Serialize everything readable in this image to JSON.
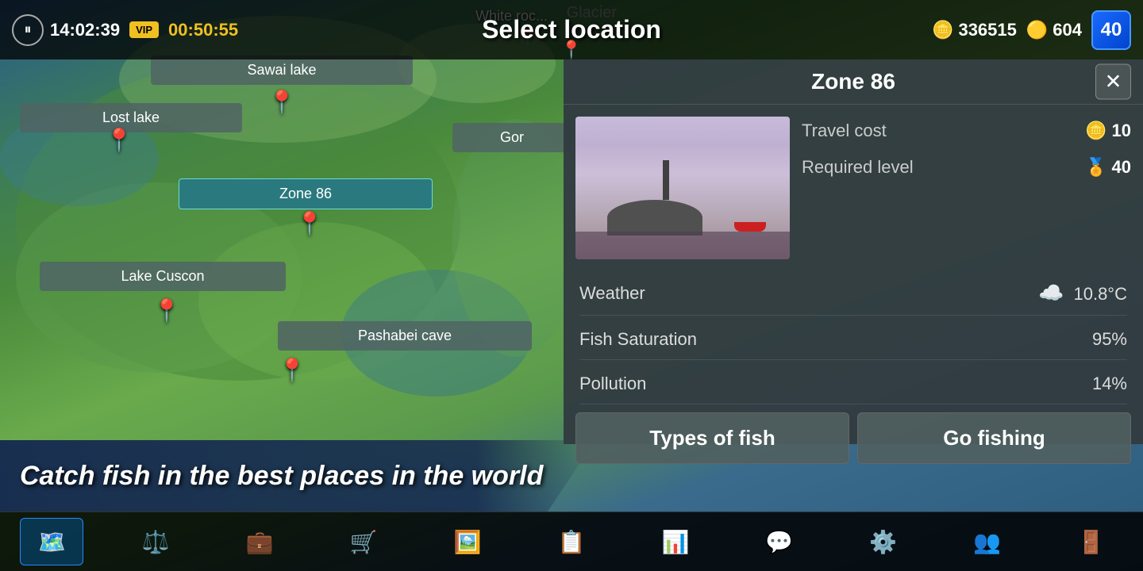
{
  "topbar": {
    "time": "14:02:39",
    "vip_label": "VIP",
    "timer": "00:50:55",
    "select_location": "Select location",
    "coins_label": "336515",
    "gold_label": "604",
    "level": "40"
  },
  "map": {
    "locations": [
      {
        "name": "Sawai lake",
        "active": false
      },
      {
        "name": "Lost lake",
        "active": false
      },
      {
        "name": "Zone 86",
        "active": true
      },
      {
        "name": "Lake Cuscon",
        "active": false
      },
      {
        "name": "Pashabei cave",
        "active": false
      },
      {
        "name": "Gor",
        "active": false
      }
    ],
    "glacier_label": "Glacier",
    "white_rocks_label": "White roc..."
  },
  "zone_panel": {
    "title": "Zone 86",
    "close_label": "✕",
    "travel_cost_label": "Travel cost",
    "travel_cost_value": "10",
    "required_level_label": "Required level",
    "required_level_value": "40",
    "weather_label": "Weather",
    "weather_value": "10.8°C",
    "fish_saturation_label": "Fish Saturation",
    "fish_saturation_value": "95%",
    "pollution_label": "Pollution",
    "pollution_value": "14%",
    "types_of_fish_btn": "Types of fish",
    "go_fishing_btn": "Go fishing"
  },
  "banner": {
    "text": "Catch fish in the best places in the world"
  },
  "navbar": {
    "items": [
      {
        "icon": "🗺️",
        "label": "map",
        "active": true
      },
      {
        "icon": "⚖️",
        "label": "balance",
        "active": false
      },
      {
        "icon": "💼",
        "label": "inventory",
        "active": false
      },
      {
        "icon": "🛒",
        "label": "shop",
        "active": false
      },
      {
        "icon": "🖼️",
        "label": "gallery",
        "active": false
      },
      {
        "icon": "📋",
        "label": "tasks",
        "active": false
      },
      {
        "icon": "📊",
        "label": "stats",
        "active": false
      },
      {
        "icon": "💬",
        "label": "chat",
        "active": false
      },
      {
        "icon": "⚙️",
        "label": "settings",
        "active": false
      },
      {
        "icon": "👥",
        "label": "social",
        "active": false
      },
      {
        "icon": "🚪",
        "label": "exit",
        "active": false
      }
    ]
  }
}
